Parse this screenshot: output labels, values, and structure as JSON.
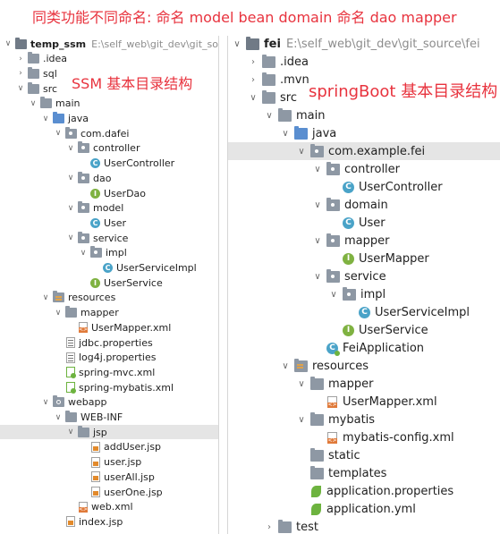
{
  "banner": "同类功能不同命名: 命名 model bean domain 命名 dao mapper",
  "left": {
    "overlay": "SSM 基本目录结构",
    "items": [
      {
        "label": "temp_ssm",
        "path": "E:\\self_web\\git_dev\\git_source\\te",
        "icon": "project",
        "arrow": "down",
        "indent": 0,
        "bold": true
      },
      {
        "label": ".idea",
        "icon": "folder",
        "arrow": "right",
        "indent": 1
      },
      {
        "label": "sql",
        "icon": "folder",
        "arrow": "right",
        "indent": 1
      },
      {
        "label": "src",
        "icon": "folder",
        "arrow": "down",
        "indent": 1
      },
      {
        "label": "main",
        "icon": "folder",
        "arrow": "down",
        "indent": 2
      },
      {
        "label": "java",
        "icon": "folder-blue",
        "arrow": "down",
        "indent": 3
      },
      {
        "label": "com.dafei",
        "icon": "package",
        "arrow": "down",
        "indent": 4
      },
      {
        "label": "controller",
        "icon": "package",
        "arrow": "down",
        "indent": 5
      },
      {
        "label": "UserController",
        "icon": "class",
        "arrow": "",
        "indent": 6
      },
      {
        "label": "dao",
        "icon": "package",
        "arrow": "down",
        "indent": 5
      },
      {
        "label": "UserDao",
        "icon": "interface",
        "arrow": "",
        "indent": 6
      },
      {
        "label": "model",
        "icon": "package",
        "arrow": "down",
        "indent": 5
      },
      {
        "label": "User",
        "icon": "class",
        "arrow": "",
        "indent": 6
      },
      {
        "label": "service",
        "icon": "package",
        "arrow": "down",
        "indent": 5
      },
      {
        "label": "impl",
        "icon": "package",
        "arrow": "down",
        "indent": 6
      },
      {
        "label": "UserServiceImpl",
        "icon": "class",
        "arrow": "",
        "indent": 7
      },
      {
        "label": "UserService",
        "icon": "interface",
        "arrow": "",
        "indent": 6
      },
      {
        "label": "resources",
        "icon": "resources",
        "arrow": "down",
        "indent": 3
      },
      {
        "label": "mapper",
        "icon": "folder",
        "arrow": "down",
        "indent": 4
      },
      {
        "label": "UserMapper.xml",
        "icon": "xml",
        "arrow": "",
        "indent": 5
      },
      {
        "label": "jdbc.properties",
        "icon": "properties",
        "arrow": "",
        "indent": 4
      },
      {
        "label": "log4j.properties",
        "icon": "properties",
        "arrow": "",
        "indent": 4
      },
      {
        "label": "spring-mvc.xml",
        "icon": "spring",
        "arrow": "",
        "indent": 4
      },
      {
        "label": "spring-mybatis.xml",
        "icon": "spring",
        "arrow": "",
        "indent": 4
      },
      {
        "label": "webapp",
        "icon": "web",
        "arrow": "down",
        "indent": 3
      },
      {
        "label": "WEB-INF",
        "icon": "folder",
        "arrow": "down",
        "indent": 4
      },
      {
        "label": "jsp",
        "icon": "folder",
        "arrow": "down",
        "indent": 5,
        "selected": true
      },
      {
        "label": "addUser.jsp",
        "icon": "jsp",
        "arrow": "",
        "indent": 6
      },
      {
        "label": "user.jsp",
        "icon": "jsp",
        "arrow": "",
        "indent": 6
      },
      {
        "label": "userAll.jsp",
        "icon": "jsp",
        "arrow": "",
        "indent": 6
      },
      {
        "label": "userOne.jsp",
        "icon": "jsp",
        "arrow": "",
        "indent": 6
      },
      {
        "label": "web.xml",
        "icon": "xml",
        "arrow": "",
        "indent": 5
      },
      {
        "label": "index.jsp",
        "icon": "jsp",
        "arrow": "",
        "indent": 4
      }
    ]
  },
  "right": {
    "overlay": "springBoot 基本目录结构",
    "items": [
      {
        "label": "fei",
        "path": "E:\\self_web\\git_dev\\git_source\\fei",
        "icon": "project",
        "arrow": "down",
        "indent": 0,
        "bold": true
      },
      {
        "label": ".idea",
        "icon": "folder",
        "arrow": "right",
        "indent": 1
      },
      {
        "label": ".mvn",
        "icon": "folder",
        "arrow": "right",
        "indent": 1
      },
      {
        "label": "src",
        "icon": "folder",
        "arrow": "down",
        "indent": 1
      },
      {
        "label": "main",
        "icon": "folder",
        "arrow": "down",
        "indent": 2
      },
      {
        "label": "java",
        "icon": "folder-blue",
        "arrow": "down",
        "indent": 3
      },
      {
        "label": "com.example.fei",
        "icon": "package",
        "arrow": "down",
        "indent": 4,
        "selected": true
      },
      {
        "label": "controller",
        "icon": "package",
        "arrow": "down",
        "indent": 5
      },
      {
        "label": "UserController",
        "icon": "class",
        "arrow": "",
        "indent": 6
      },
      {
        "label": "domain",
        "icon": "package",
        "arrow": "down",
        "indent": 5
      },
      {
        "label": "User",
        "icon": "class",
        "arrow": "",
        "indent": 6
      },
      {
        "label": "mapper",
        "icon": "package",
        "arrow": "down",
        "indent": 5
      },
      {
        "label": "UserMapper",
        "icon": "interface",
        "arrow": "",
        "indent": 6
      },
      {
        "label": "service",
        "icon": "package",
        "arrow": "down",
        "indent": 5
      },
      {
        "label": "impl",
        "icon": "package",
        "arrow": "down",
        "indent": 6
      },
      {
        "label": "UserServiceImpl",
        "icon": "class",
        "arrow": "",
        "indent": 7
      },
      {
        "label": "UserService",
        "icon": "interface",
        "arrow": "",
        "indent": 6
      },
      {
        "label": "FeiApplication",
        "icon": "boot",
        "arrow": "",
        "indent": 5
      },
      {
        "label": "resources",
        "icon": "resources",
        "arrow": "down",
        "indent": 3
      },
      {
        "label": "mapper",
        "icon": "folder",
        "arrow": "down",
        "indent": 4
      },
      {
        "label": "UserMapper.xml",
        "icon": "xml",
        "arrow": "",
        "indent": 5
      },
      {
        "label": "mybatis",
        "icon": "folder",
        "arrow": "down",
        "indent": 4
      },
      {
        "label": "mybatis-config.xml",
        "icon": "xml",
        "arrow": "",
        "indent": 5
      },
      {
        "label": "static",
        "icon": "folder",
        "arrow": "",
        "indent": 4
      },
      {
        "label": "templates",
        "icon": "folder",
        "arrow": "",
        "indent": 4
      },
      {
        "label": "application.properties",
        "icon": "leaf",
        "arrow": "",
        "indent": 4
      },
      {
        "label": "application.yml",
        "icon": "leaf",
        "arrow": "",
        "indent": 4
      },
      {
        "label": "test",
        "icon": "folder",
        "arrow": "right",
        "indent": 2
      }
    ]
  }
}
